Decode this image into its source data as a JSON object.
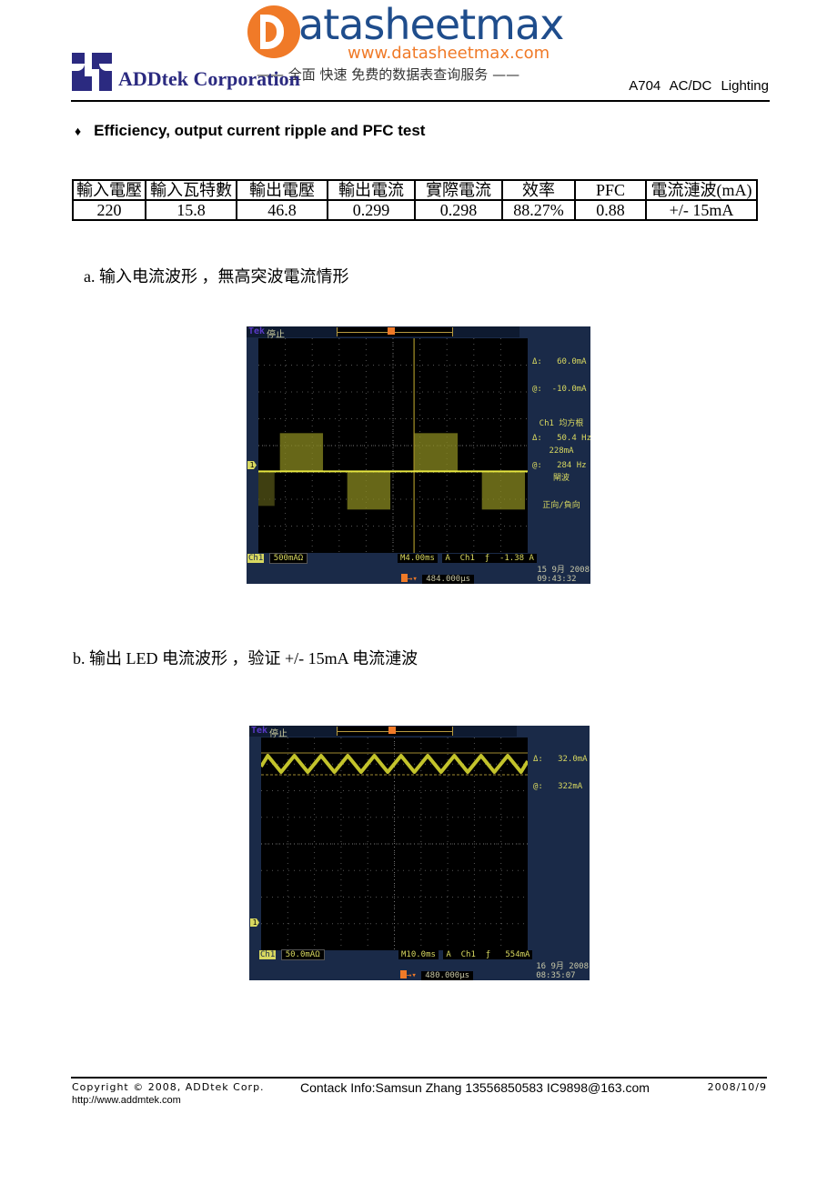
{
  "watermark": {
    "brand": "atasheetmax",
    "url": "www.datasheetmax.com",
    "slogan": "—— 全面  快速  免费的数据表查询服务 ——"
  },
  "header": {
    "company": "ADDtek Corporation",
    "doc_tag": "A704 AC/DC Lighting"
  },
  "section": {
    "bullet": "♦",
    "title": "Efficiency, output current ripple and PFC test"
  },
  "spec_table": {
    "headers": [
      "輸入電壓",
      "輸入瓦特數",
      "輸出電壓",
      "輸出電流",
      "實際電流",
      "效率",
      "PFC",
      "電流漣波(mA)"
    ],
    "rows": [
      [
        "220",
        "15.8",
        "46.8",
        "0.299",
        "0.298",
        "88.27%",
        "0.88",
        "+/- 15mA"
      ]
    ]
  },
  "captions": {
    "a": "a.  输入电流波形 ，無高突波電流情形",
    "b": "b.   输出 LED 电流波形 ，验证  +/- 15mA  电流漣波"
  },
  "scopes": [
    {
      "brand": "Tek",
      "status": "停止",
      "trigger_marker": "T",
      "cursor_readouts": [
        "Δ:   60.0mA",
        "@:  -10.0mA",
        "",
        "Δ:   50.4 Hz",
        "@:   284 Hz"
      ],
      "measurement": [
        "Ch1 均方根",
        "228mA",
        "閘波",
        "正向/負向"
      ],
      "channel": "Ch1",
      "channel_scale": "500mAΩ",
      "timebase": "M4.00ms",
      "trigger": "A  Ch1  ƒ  -1.38 A",
      "delay": "484.000µs",
      "date": "15 9月  2008",
      "time": "09:43:32",
      "ground_marker": "1"
    },
    {
      "brand": "Tek",
      "status": "停止",
      "trigger_marker": "T",
      "cursor_readouts": [
        "Δ:   32.0mA",
        "@:   322mA"
      ],
      "measurement": [],
      "channel": "Ch1",
      "channel_scale": "50.0mAΩ",
      "timebase": "M10.0ms",
      "trigger": "A  Ch1  ƒ   554mA",
      "delay": "480.000µs",
      "date": "16 9月  2008",
      "time": "08:35:07",
      "ground_marker": "1"
    }
  ],
  "chart_data": [
    {
      "type": "line",
      "title": "Input current waveform",
      "xlabel": "time (4.00 ms/div)",
      "ylabel": "current (500 mA/div)",
      "x_divisions": 10,
      "y_divisions": 8,
      "description": "AC input current bursts alternating positive/negative around zero; ~50.4 Hz",
      "series": [
        {
          "name": "Ch1",
          "rms_mA": 228,
          "cursor_delta_mA": 60.0,
          "cursor_at_mA": -10.0,
          "freq_hz": 50.4
        }
      ]
    },
    {
      "type": "line",
      "title": "Output LED current ripple",
      "xlabel": "time (10.0 ms/div)",
      "ylabel": "current (50.0 mA/div)",
      "x_divisions": 10,
      "y_divisions": 8,
      "description": "Triangular ripple, ~10 cycles across screen",
      "series": [
        {
          "name": "Ch1",
          "cursor_delta_mA": 32.0,
          "cursor_at_mA": 322,
          "cycles_on_screen": 10
        }
      ]
    }
  ],
  "footer": {
    "copyright": "Copyright © 2008, ADDtek Corp.",
    "contact": "Contack Info:Samsun Zhang   13556850583  IC9898@163.com",
    "date": "2008/10/9",
    "url": "http://www.addmtek.com"
  }
}
